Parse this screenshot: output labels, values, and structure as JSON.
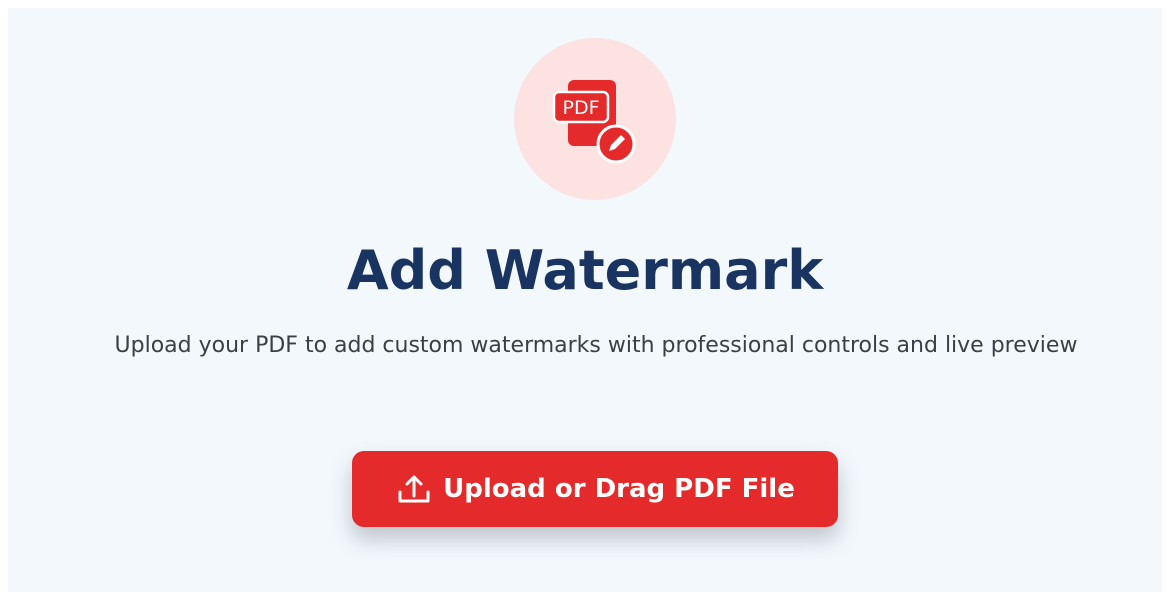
{
  "hero": {
    "icon": "pdf-edit-icon",
    "icon_badge_text": "PDF",
    "title": "Add Watermark",
    "subtitle": "Upload your PDF to add custom watermarks with professional controls and live preview"
  },
  "upload_button": {
    "icon": "upload-icon",
    "label": "Upload or Drag PDF File"
  },
  "colors": {
    "background": "#f2f8fc",
    "icon_circle": "#fde2e2",
    "accent_red": "#e42a2a",
    "title": "#1a3461",
    "subtitle": "#3a3f48"
  }
}
